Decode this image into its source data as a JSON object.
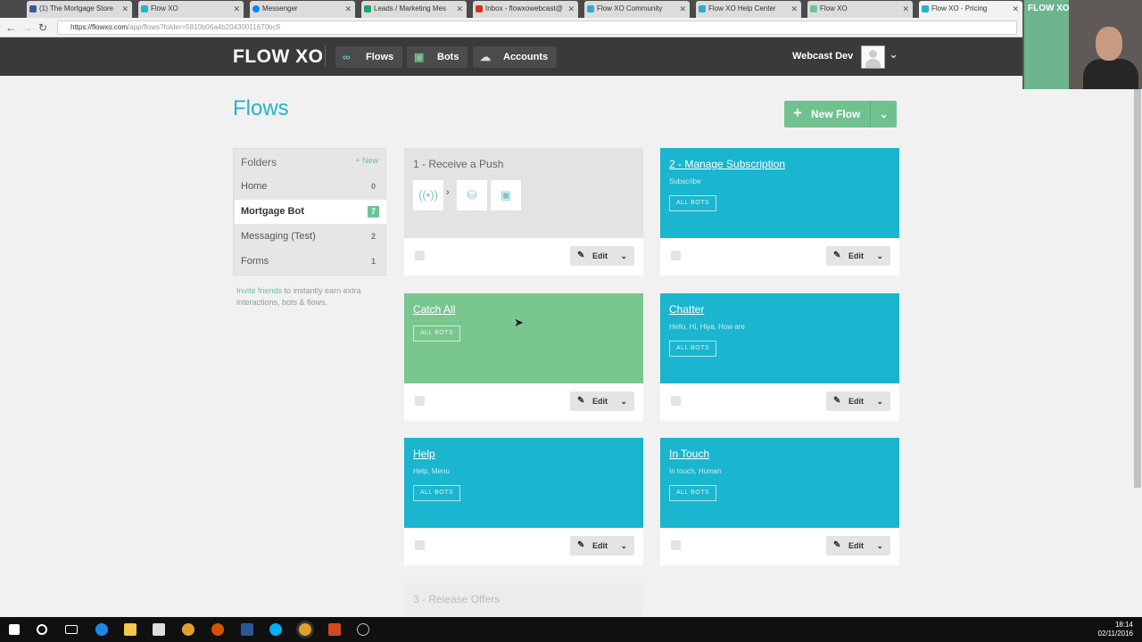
{
  "browser": {
    "tabs": [
      {
        "title": "(1) The Mortgage Store",
        "color": "#3b5998"
      },
      {
        "title": "Flow XO",
        "color": "#27b3c9"
      },
      {
        "title": "Messenger",
        "color": "#0084ff"
      },
      {
        "title": "Leads / Marketing Mes",
        "color": "#1fa463"
      },
      {
        "title": "Inbox - flowxowebcast@",
        "color": "#d93025"
      },
      {
        "title": "Flow XO Community",
        "color": "#27b3c9"
      },
      {
        "title": "Flow XO Help Center",
        "color": "#27b3c9"
      },
      {
        "title": "Flow XO",
        "color": "#6cc493"
      },
      {
        "title": "Flow XO - Pricing",
        "color": "#27b3c9"
      }
    ],
    "url_host": "https://flowxo.com",
    "url_path": "/app/flows?folder=5810b06a4b20430011670bc9"
  },
  "header": {
    "logo": "FLOW XO",
    "nav": [
      {
        "label": "Flows",
        "icon": "flows-icon",
        "glyph": "∞"
      },
      {
        "label": "Bots",
        "icon": "bot-icon",
        "glyph": "▣"
      },
      {
        "label": "Accounts",
        "icon": "cloud-icon",
        "glyph": "☁"
      }
    ],
    "user": "Webcast Dev"
  },
  "page": {
    "title": "Flows",
    "new_flow": "New Flow"
  },
  "folders": {
    "heading": "Folders",
    "new_label": "+ New",
    "items": [
      {
        "label": "Home",
        "count": "0"
      },
      {
        "label": "Mortgage Bot",
        "count": "7"
      },
      {
        "label": "Messaging (Test)",
        "count": "2"
      },
      {
        "label": "Forms",
        "count": "1"
      }
    ],
    "invite_link": "Invite friends",
    "invite_text": " to instantly earn extra interactions, bots & flows."
  },
  "flows": [
    {
      "title": "1 - Receive a Push",
      "subtitle": "",
      "bots": ""
    },
    {
      "title": "2 - Manage Subscription",
      "subtitle": "Subscribe",
      "bots": "ALL BOTS"
    },
    {
      "title": "Catch All",
      "subtitle": "",
      "bots": "ALL BOTS"
    },
    {
      "title": "Chatter",
      "subtitle": "Hello, Hi, Hiya, How are",
      "bots": "ALL BOTS"
    },
    {
      "title": "Help",
      "subtitle": "Help, Menu",
      "bots": "ALL BOTS"
    },
    {
      "title": "In Touch",
      "subtitle": "In touch, Human",
      "bots": "ALL BOTS"
    },
    {
      "title": "3 - Release Offers",
      "subtitle": "",
      "bots": ""
    }
  ],
  "edit_label": "Edit",
  "colors": {
    "accent": "#27b3c9",
    "green": "#6cc493",
    "card_blue": "#1ab5ce",
    "card_green": "#7ac68f",
    "header": "#3a3a3a"
  },
  "taskbar": {
    "time": "18:14",
    "date": "02/11/2016"
  },
  "webcam": {
    "banner": "FLOW XO"
  }
}
